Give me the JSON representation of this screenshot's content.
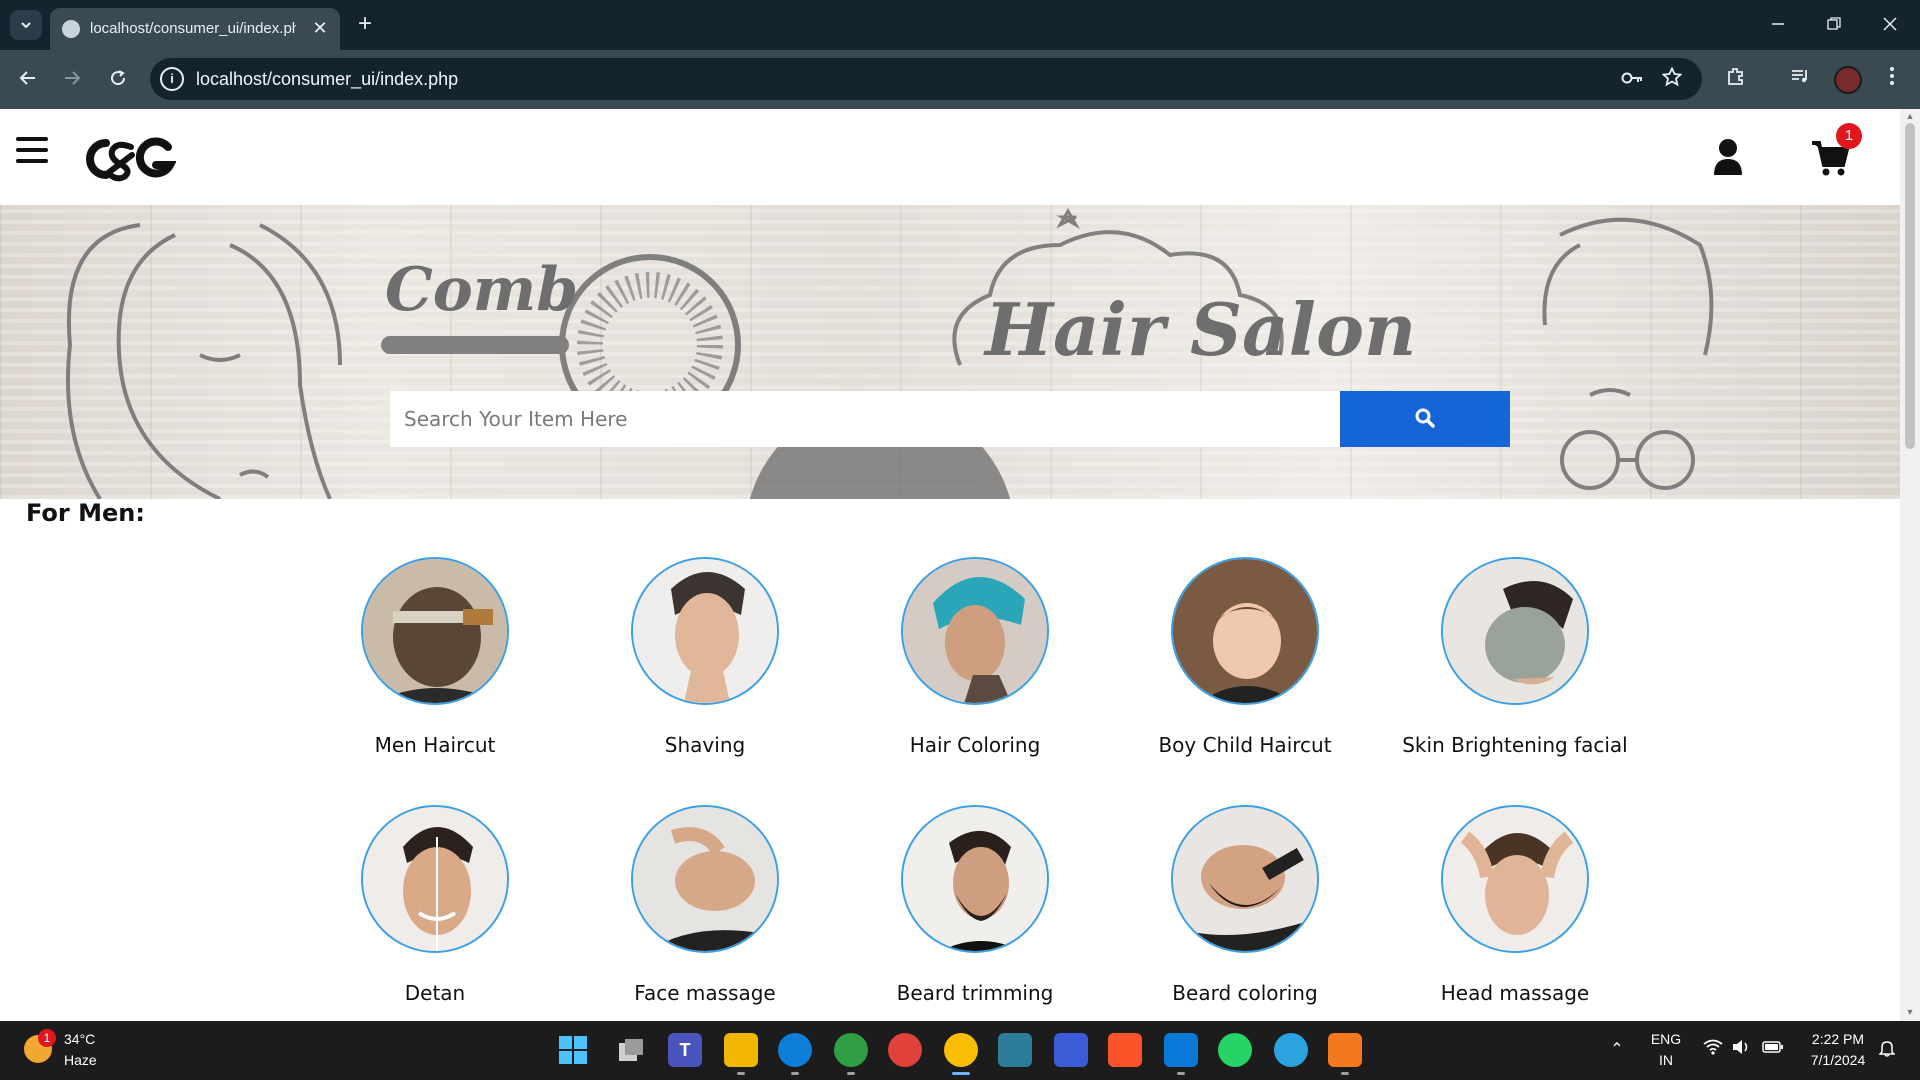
{
  "browser": {
    "tab_title": "localhost/consumer_ui/index.php",
    "url": "localhost/consumer_ui/index.php",
    "new_tab_label": "+",
    "close_tab_label": "✕"
  },
  "site": {
    "cart_count": "1",
    "search_placeholder": "Search Your Item Here",
    "section_title": "For Men:",
    "banner_text": {
      "comb": "Comb",
      "salon": "Hair Salon"
    },
    "services": [
      {
        "label": "Men Haircut",
        "icon": "haircut-photo"
      },
      {
        "label": "Shaving",
        "icon": "shaving-photo"
      },
      {
        "label": "Hair Coloring",
        "icon": "hair-coloring-photo"
      },
      {
        "label": "Boy Child Haircut",
        "icon": "child-haircut-photo"
      },
      {
        "label": "Skin Brightening facial",
        "icon": "facial-photo"
      },
      {
        "label": "Detan",
        "icon": "detan-photo"
      },
      {
        "label": "Face massage",
        "icon": "face-massage-photo"
      },
      {
        "label": "Beard trimming",
        "icon": "beard-trimming-photo"
      },
      {
        "label": "Beard coloring",
        "icon": "beard-coloring-photo"
      },
      {
        "label": "Head massage",
        "icon": "head-massage-photo"
      }
    ]
  },
  "taskbar": {
    "weather_temp": "34°C",
    "weather_condition": "Haze",
    "weather_badge": "1",
    "language": "ENG",
    "region": "IN",
    "time": "2:22 PM",
    "date": "7/1/2024"
  },
  "colors": {
    "accent_blue": "#1565d8",
    "badge_red": "#e1171e",
    "circle_border": "#3a9fe6"
  }
}
